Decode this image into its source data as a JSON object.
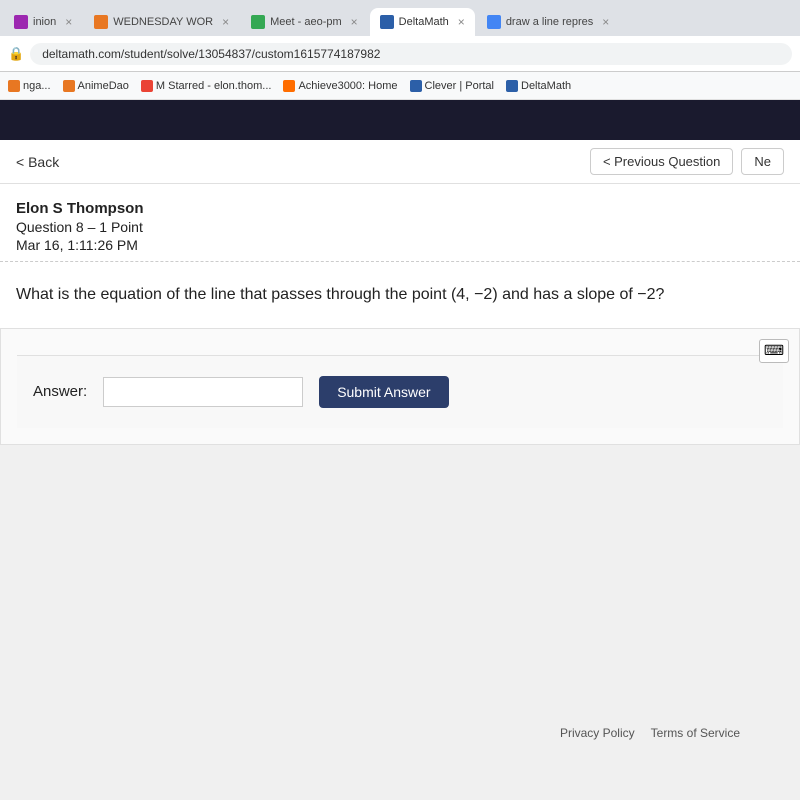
{
  "browser": {
    "tabs": [
      {
        "id": "tab1",
        "label": "inion",
        "active": false,
        "favicon_color": "#9c27b0"
      },
      {
        "id": "tab2",
        "label": "WEDNESDAY WOR",
        "active": false,
        "favicon_color": "#e87722"
      },
      {
        "id": "tab3",
        "label": "Meet - aeo-pm",
        "active": false,
        "favicon_color": "#34a853"
      },
      {
        "id": "tab4",
        "label": "DeltaMath",
        "active": true,
        "favicon_color": "#2c5fa8"
      },
      {
        "id": "tab5",
        "label": "draw a line repres",
        "active": false,
        "favicon_color": "#4285f4"
      }
    ],
    "url": "deltamath.com/student/solve/13054837/custom1615774187982",
    "bookmarks": [
      {
        "label": "nga...",
        "favicon_color": "#e87722"
      },
      {
        "label": "AnimeDao",
        "favicon_color": "#7c4dff"
      },
      {
        "label": "M Starred - elon.thom...",
        "favicon_color": "#ea4335"
      },
      {
        "label": "Achieve3000: Home",
        "favicon_color": "#ff6d00"
      },
      {
        "label": "Clever | Portal",
        "favicon_color": "#4285f4"
      },
      {
        "label": "DeltaMath",
        "favicon_color": "#2c5fa8"
      }
    ]
  },
  "nav": {
    "back_label": "< Back",
    "prev_label": "< Previous Question",
    "next_label": "Ne"
  },
  "question": {
    "student_name": "Elon S Thompson",
    "question_number": "Question 8 – 1 Point",
    "date": "Mar 16, 1:11:26 PM",
    "body": "What is the equation of the line that passes through the point (4, −2) and has a slope of −2?",
    "answer_label": "Answer:",
    "answer_placeholder": "",
    "submit_label": "Submit Answer"
  },
  "footer": {
    "privacy_label": "Privacy Policy",
    "terms_label": "Terms of Service"
  }
}
